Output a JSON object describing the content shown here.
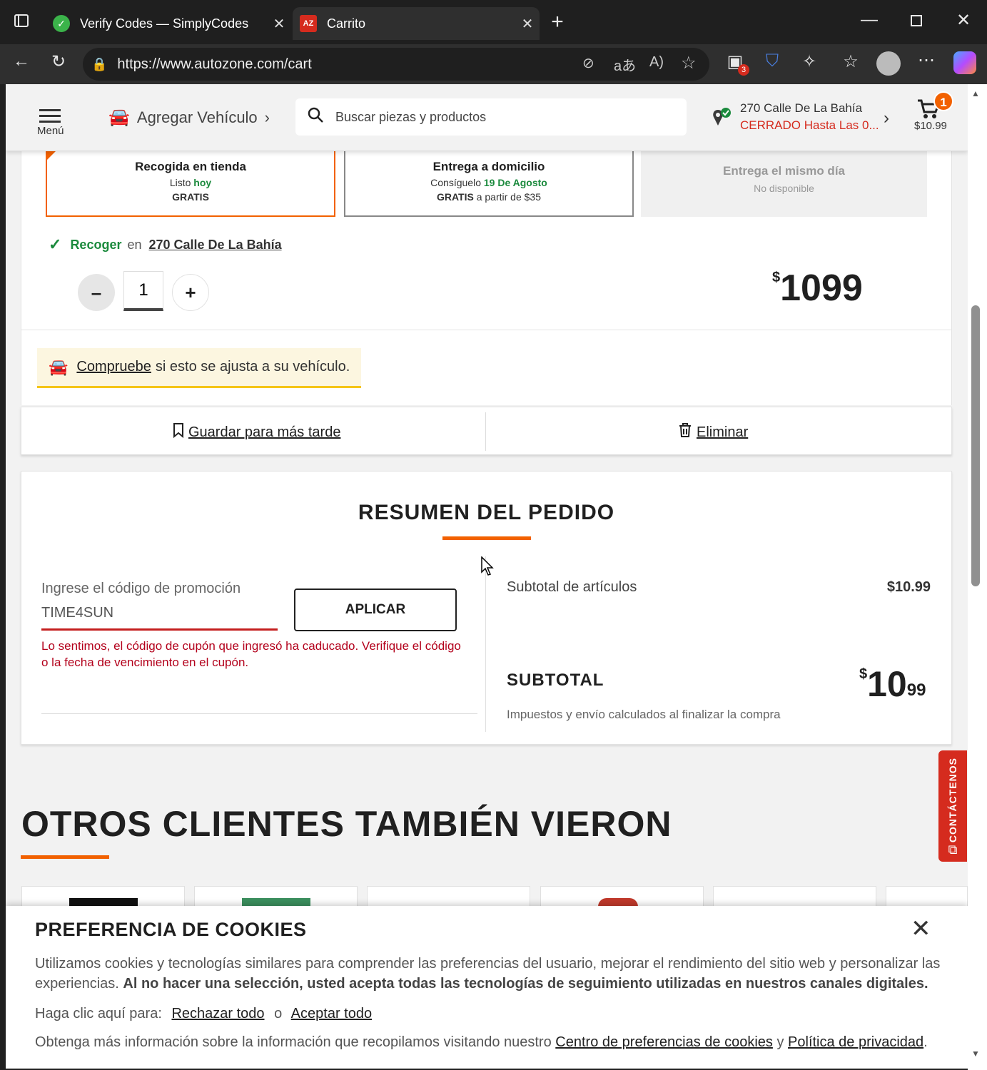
{
  "browser": {
    "tabs": [
      {
        "title": "Verify Codes — SimplyCodes",
        "favicon": "simplycodes-icon",
        "active": false
      },
      {
        "title": "Carrito",
        "favicon": "autozone-icon",
        "active": true
      }
    ],
    "url": "https://www.autozone.com/cart",
    "extension_badge": "3"
  },
  "header": {
    "menu_label": "Menú",
    "add_vehicle": "Agregar Vehículo",
    "search_placeholder": "Buscar piezas y productos",
    "store_address": "270 Calle De La Bahía",
    "store_status": "CERRADO Hasta Las 0...",
    "cart_count": "1",
    "cart_total": "$10.99"
  },
  "fulfillment": {
    "pickup": {
      "title": "Recogida en tienda",
      "line1": "Listo",
      "line1_highlight": "hoy",
      "line2": "GRATIS"
    },
    "delivery": {
      "title": "Entrega a domicilio",
      "line1": "Consíguelo",
      "line1_highlight": "19 De Agosto",
      "line2_bold": "GRATIS",
      "line2": "a partir de $35"
    },
    "sameday": {
      "title": "Entrega el mismo día",
      "line1": "No disponible"
    },
    "pickup_confirm": "Recoger",
    "pickup_confirm_mid": "en",
    "pickup_store": "270 Calle De La Bahía"
  },
  "item": {
    "quantity": "1",
    "price_dollars": "10",
    "price_cents": "99",
    "price_symbol": "$",
    "fit_check_link": "Compruebe",
    "fit_check_text": "si esto se ajusta a su vehículo.",
    "save_later": "Guardar para más tarde",
    "remove": "Eliminar"
  },
  "summary": {
    "title": "RESUMEN DEL PEDIDO",
    "promo_label": "Ingrese el código de promoción",
    "promo_value": "TIME4SUN",
    "apply": "APLICAR",
    "promo_error": "Lo sentimos, el código de cupón que ingresó ha caducado. Verifique el código o la fecha de vencimiento en el cupón.",
    "items_subtotal_label": "Subtotal de artículos",
    "items_subtotal_value": "$10.99",
    "subtotal_label": "SUBTOTAL",
    "subtotal_symbol": "$",
    "subtotal_dollars": "10",
    "subtotal_cents": "99",
    "tax_note": "Impuestos y envío calculados al finalizar la compra"
  },
  "recommendations": {
    "title": "OTROS CLIENTES TAMBIÉN VIERON"
  },
  "contact_tab": "CONTÁCTENOS",
  "cookies": {
    "title": "PREFERENCIA DE COOKIES",
    "body_normal": "Utilizamos cookies y tecnologías similares para comprender las preferencias del usuario, mejorar el rendimiento del sitio web y personalizar las experiencias.",
    "body_bold": "Al no hacer una selección, usted acepta todas las tecnologías de seguimiento utilizadas en nuestros canales digitales.",
    "click_here": "Haga clic aquí para:",
    "reject_all": "Rechazar todo",
    "or": "o",
    "accept_all": "Aceptar todo",
    "more_info": "Obtenga más información sobre la información que recopilamos visitando nuestro",
    "pref_center": "Centro de preferencias de cookies",
    "and": "y",
    "privacy": "Política de privacidad",
    "period": "."
  },
  "colors": {
    "accent_orange": "#f26100",
    "error_red": "#b3001b",
    "autozone_red": "#d52b1e",
    "fit_yellow": "#f5c518"
  }
}
